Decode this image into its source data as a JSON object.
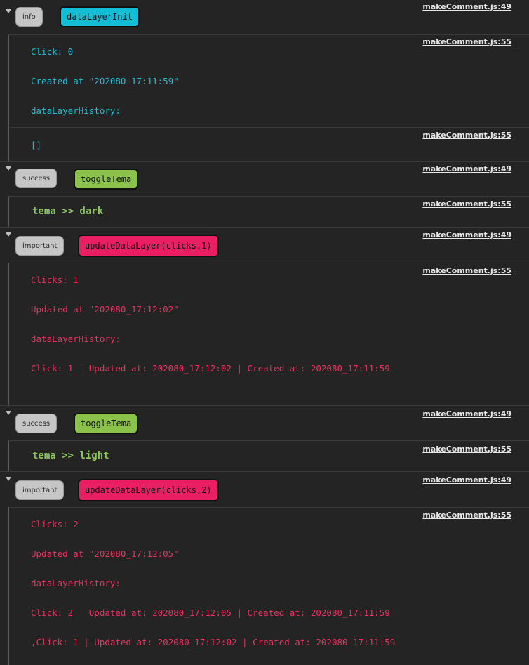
{
  "colors": {
    "background": "#242424",
    "info_event": "#14bdd6",
    "success_event": "#8bc34a",
    "important_event": "#e91e63",
    "info_text": "#1ebfd6",
    "success_text": "#8bc55a",
    "important_text": "#e8325f"
  },
  "groups": [
    {
      "badge": "info",
      "event": "dataLayerInit",
      "header_source": "makeComment.js:49",
      "messages": [
        {
          "source": "makeComment.js:55",
          "lines": [
            "Click: 0",
            "Created at \"202080_17:11:59\"",
            "dataLayerHistory:"
          ]
        },
        {
          "source": "makeComment.js:55",
          "lines": [
            "[]"
          ]
        }
      ]
    },
    {
      "badge": "success",
      "event": "toggleTema",
      "header_source": "makeComment.js:49",
      "messages": [
        {
          "source": "makeComment.js:55",
          "lines": [
            "tema >> dark"
          ]
        }
      ]
    },
    {
      "badge": "important",
      "event": "updateDataLayer(clicks,1)",
      "header_source": "makeComment.js:49",
      "messages": [
        {
          "source": "makeComment.js:55",
          "lines": [
            "Clicks: 1",
            "Updated at \"202080_17:12:02\"",
            "dataLayerHistory:",
            "Click: 1 | Updated at: 202080_17:12:02 | Created at: 202080_17:11:59"
          ]
        }
      ]
    },
    {
      "badge": "success",
      "event": "toggleTema",
      "header_source": "makeComment.js:49",
      "messages": [
        {
          "source": "makeComment.js:55",
          "lines": [
            "tema >> light"
          ]
        }
      ]
    },
    {
      "badge": "important",
      "event": "updateDataLayer(clicks,2)",
      "header_source": "makeComment.js:49",
      "messages": [
        {
          "source": "makeComment.js:55",
          "lines": [
            "Clicks: 2",
            "Updated at \"202080_17:12:05\"",
            "dataLayerHistory:",
            "Click: 2 | Updated at: 202080_17:12:05 | Created at: 202080_17:11:59",
            ",Click: 1 | Updated at: 202080_17:12:02 | Created at: 202080_17:11:59"
          ]
        }
      ]
    }
  ]
}
